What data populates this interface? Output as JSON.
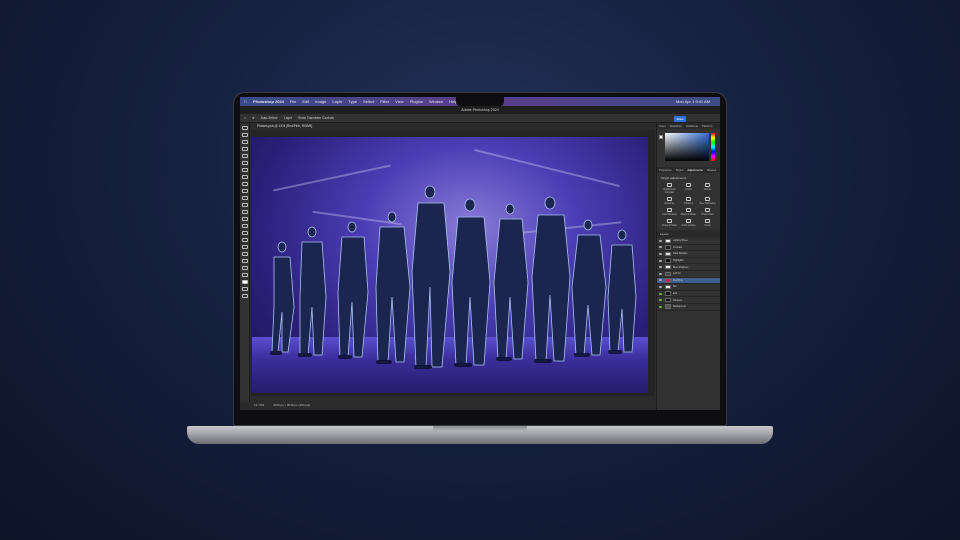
{
  "menubar": {
    "app_name": "Photoshop 2024",
    "menus": [
      "File",
      "Edit",
      "Image",
      "Layer",
      "Type",
      "Select",
      "Filter",
      "View",
      "Plugins",
      "Window",
      "Help"
    ],
    "clock": "Mon Apr 1  9:41 AM"
  },
  "window": {
    "title": "Adobe Photoshop 2024"
  },
  "options_bar": {
    "auto_select": "Auto-Select:",
    "layer_select": "Layer",
    "transform_controls": "Show Transform Controls",
    "share_label": "Share"
  },
  "document": {
    "tab_title": "Phases.psb @ 13% (Red/Pink, RGB/8)"
  },
  "statusbar": {
    "zoom": "12.73%",
    "dimensions": "4970 px x 3039 px (300 ppi)"
  },
  "panels": {
    "color_tabs": [
      "Color",
      "Swatches",
      "Gradients",
      "Patterns"
    ],
    "adj_tabs": [
      "Properties",
      "Styles",
      "Adjustments",
      "Shapes"
    ],
    "adjustments_title": "Single adjustments",
    "adjustments": [
      "Brightness/ Contrast",
      "Levels",
      "Curves",
      "Exposure",
      "Vibrance",
      "Hue/ Saturation",
      "Color Balance",
      "Black & White",
      "Photo Filter",
      "Channel Mixer",
      "Color Lookup",
      "Invert"
    ],
    "layers_title": "Layers",
    "layers": [
      "Lighting Fixes",
      "Contrast",
      "Dark Shadow",
      "Highlights",
      "Blue Shadows",
      "Left FX",
      "Red/Pink",
      "BG",
      "Edit",
      "Dancers",
      "Background"
    ]
  },
  "colors": {
    "accent": "#2f6fe0",
    "selected_layer": "#3e5e8e"
  }
}
